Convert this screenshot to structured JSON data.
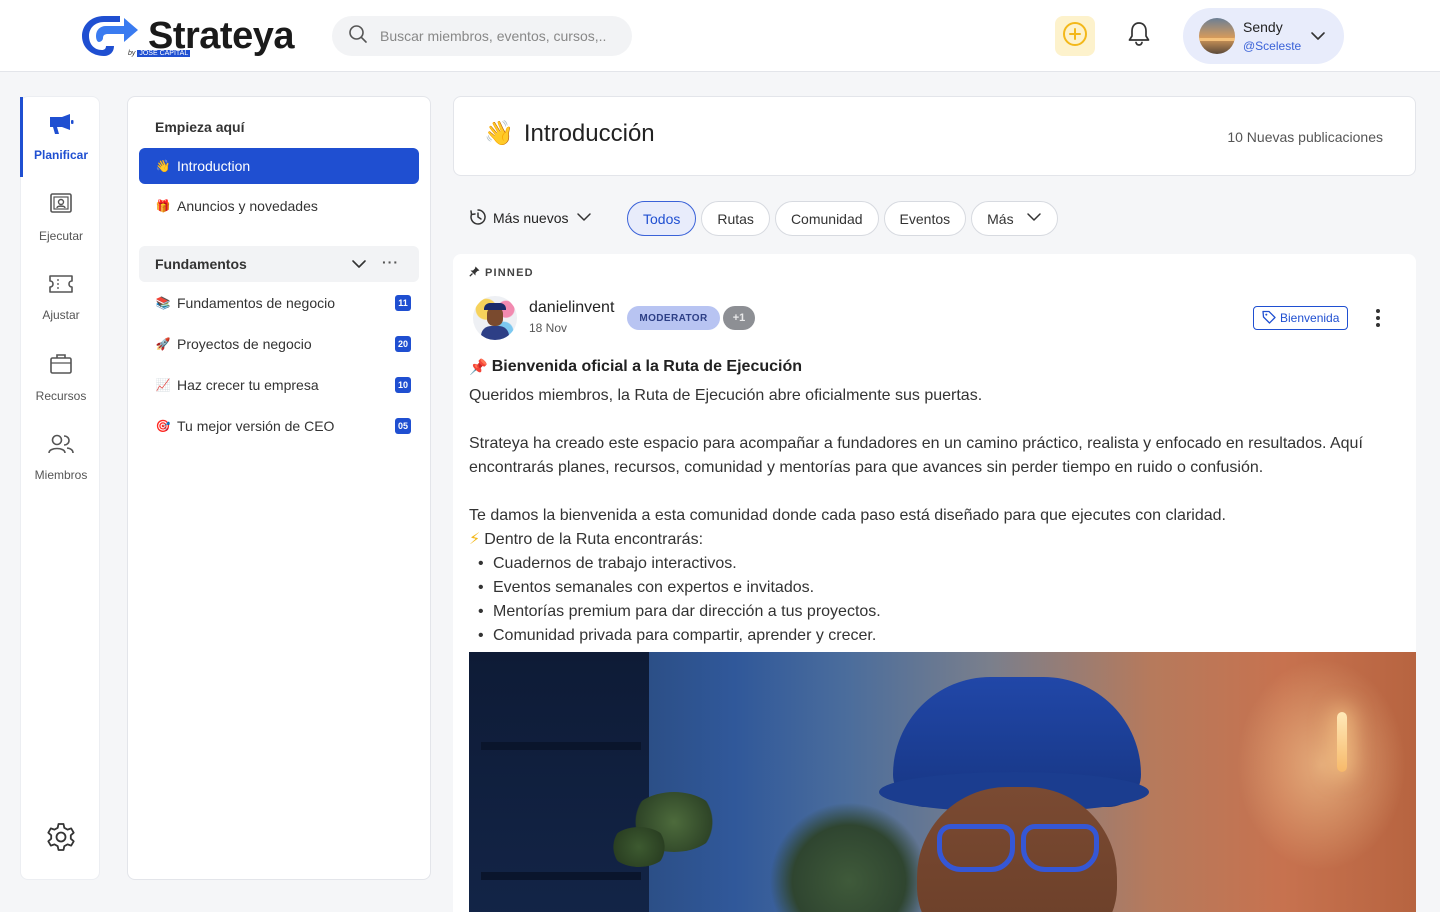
{
  "header": {
    "logo_text": "Strateya",
    "logo_sub_prefix": "by",
    "logo_sub_brand": "JOSE CAPITAL",
    "search_placeholder": "Buscar miembros, eventos, cursos,..",
    "user": {
      "name": "Sendy",
      "handle": "@Sceleste"
    },
    "colors": {
      "accent": "#1f4fd1",
      "plus_bg": "#fdf2cc",
      "plus_icon": "#f3b81a"
    }
  },
  "rail": {
    "items": [
      {
        "label": "Planificar",
        "icon": "megaphone-icon",
        "active": true
      },
      {
        "label": "Ejecutar",
        "icon": "presentation-icon",
        "active": false
      },
      {
        "label": "Ajustar",
        "icon": "ticket-icon",
        "active": false
      },
      {
        "label": "Recursos",
        "icon": "briefcase-icon",
        "active": false
      },
      {
        "label": "Miembros",
        "icon": "users-icon",
        "active": false
      }
    ],
    "settings_icon": "gear-icon"
  },
  "course": {
    "section_title": "Empieza  aquí",
    "top_items": [
      {
        "emoji": "👋",
        "label": "Introduction",
        "active": true
      },
      {
        "emoji": "🎁",
        "label": "Anuncios y novedades",
        "active": false
      }
    ],
    "group_title": "Fundamentos",
    "group_items": [
      {
        "emoji": "📚",
        "label": "Fundamentos de negocio",
        "count": "11"
      },
      {
        "emoji": "🚀",
        "label": "Proyectos de negocio",
        "count": "20"
      },
      {
        "emoji": "📈",
        "label": "Haz crecer tu empresa",
        "count": "10"
      },
      {
        "emoji": "🎯",
        "label": "Tu mejor versión de CEO",
        "count": "05"
      }
    ]
  },
  "main": {
    "title_emoji": "👋",
    "title": "Introducción",
    "new_posts": "10 Nuevas publicaciones",
    "sort_label": "Más nuevos",
    "filters": [
      "Todos",
      "Rutas",
      "Comunidad",
      "Eventos",
      "Más"
    ],
    "active_filter": "Todos"
  },
  "post": {
    "pinned_label": "PINNED",
    "author": "danielinvent",
    "date": "18 Nov",
    "role_badge": "MODERATOR",
    "extra_badge": "+1",
    "tag": "Bienvenida",
    "title_emoji": "📌",
    "title": "Bienvenida oficial a la Ruta de Ejecución",
    "p1": "Queridos miembros, la Ruta de Ejecución abre oficialmente sus puertas.",
    "p2": "Strateya ha creado este espacio para acompañar a fundadores en un camino práctico, realista y enfocado en resultados. Aquí encontrarás planes, recursos, comunidad y mentorías para que avances sin perder tiempo en ruido o confusión.",
    "p3": "Te damos la bienvenida a esta comunidad donde cada paso está diseñado para que ejecutes con claridad.",
    "list_intro_emoji": "⚡",
    "list_intro": "Dentro de la Ruta encontrarás:",
    "bullets": [
      "Cuadernos de trabajo interactivos.",
      "Eventos semanales con expertos e invitados.",
      "Mentorías premium para dar dirección a tus proyectos.",
      "Comunidad privada para compartir, aprender y crecer."
    ]
  }
}
